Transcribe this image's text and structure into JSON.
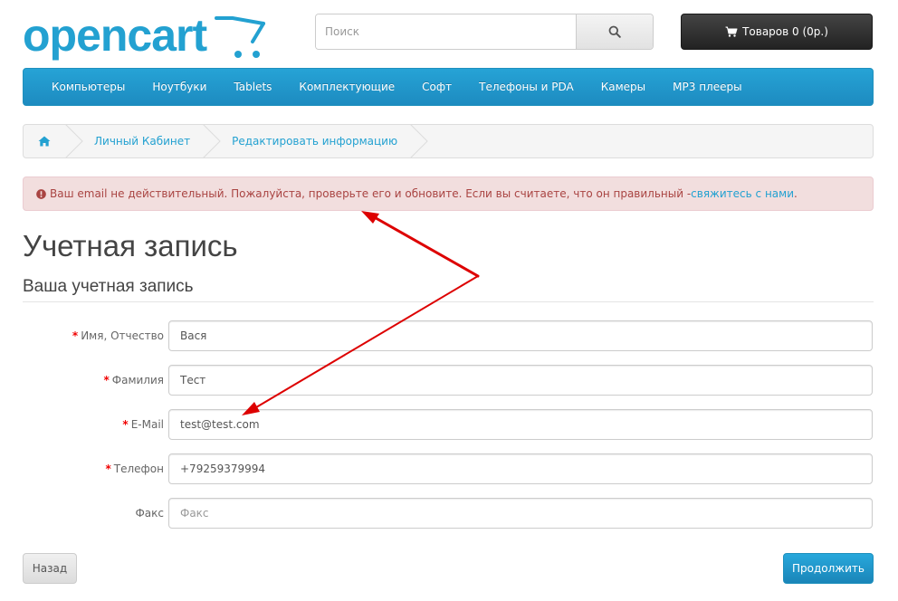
{
  "header": {
    "logo_text": "opencart",
    "search": {
      "placeholder": "Поиск",
      "icon": "search-icon"
    },
    "cart": {
      "label": "Товаров 0 (0р.)",
      "icon": "shopping-cart-icon"
    }
  },
  "menu": {
    "items": [
      "Компьютеры",
      "Ноутбуки",
      "Tablets",
      "Комплектующие",
      "Софт",
      "Телефоны и PDA",
      "Камеры",
      "MP3 плееры"
    ]
  },
  "breadcrumb": {
    "home_icon": "home-icon",
    "items": [
      "Личный Кабинет",
      "Редактировать информацию"
    ]
  },
  "alert": {
    "icon": "exclamation-circle-icon",
    "message": "Ваш email не действительный. Пожалуйста, проверьте его и обновите. Если вы считаете, что он правильный - ",
    "link_text": "свяжитесь с нами",
    "suffix": "."
  },
  "page": {
    "title": "Учетная запись",
    "section_title": "Ваша учетная запись"
  },
  "form": {
    "firstname": {
      "label": "Имя, Отчество",
      "required": "*",
      "value": "Вася"
    },
    "lastname": {
      "label": "Фамилия",
      "required": "*",
      "value": "Тест"
    },
    "email": {
      "label": "E-Mail",
      "required": "*",
      "value": "test@test.com"
    },
    "telephone": {
      "label": "Телефон",
      "required": "*",
      "value": "+79259379994"
    },
    "fax": {
      "label": "Факс",
      "placeholder": "Факс"
    }
  },
  "buttons": {
    "back": "Назад",
    "continue": "Продолжить"
  },
  "colors": {
    "brand": "#23a1d1",
    "alert_bg": "#f2dede",
    "alert_text": "#a94442",
    "required": "#f00000",
    "annotation_arrow": "#dd0000"
  }
}
